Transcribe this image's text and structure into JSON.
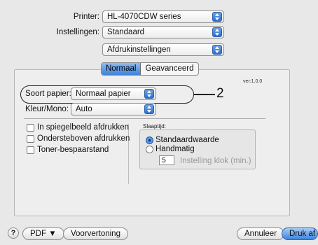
{
  "header": {
    "printer_label": "Printer:",
    "printer_value": "HL-4070CDW series",
    "settings_label": "Instellingen:",
    "settings_value": "Standaard",
    "pane_value": "Afdrukinstellingen"
  },
  "tabs": [
    {
      "label": "Normaal",
      "active": true
    },
    {
      "label": "Geavanceerd",
      "active": false
    }
  ],
  "version": "ver:1.0.0",
  "callout_number": "2",
  "media": {
    "label": "Soort papier:",
    "value": "Normaal papier"
  },
  "color": {
    "label": "Kleur/Mono:",
    "value": "Auto"
  },
  "checkboxes": [
    {
      "label": "In spiegelbeeld afdrukken",
      "checked": false
    },
    {
      "label": "Ondersteboven afdrukken",
      "checked": false
    },
    {
      "label": "Toner-bespaarstand",
      "checked": false
    }
  ],
  "sleep": {
    "title": "Slaaptijd:",
    "option_default": "Standaardwaarde",
    "option_manual": "Handmatig",
    "selected": "Standaardwaarde",
    "minutes_value": "5",
    "minutes_label": "Instelling klok (min.)"
  },
  "footer": {
    "help": "?",
    "pdf": "PDF ▼",
    "preview": "Voorvertoning",
    "cancel": "Annuleer",
    "print": "Druk af"
  }
}
